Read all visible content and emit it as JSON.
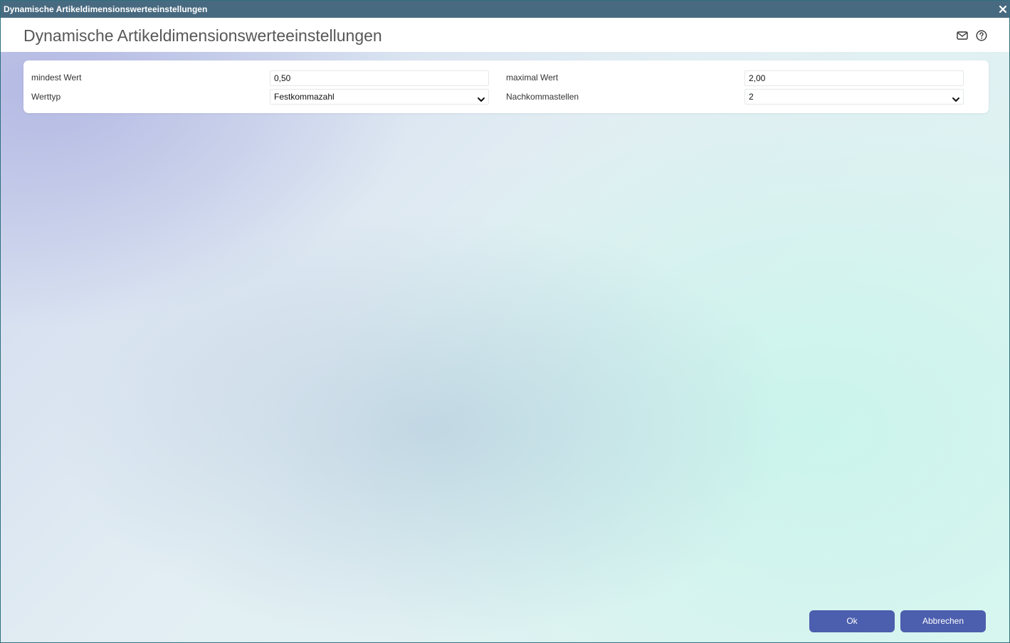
{
  "window": {
    "title": "Dynamische Artikeldimensionswerteeinstellungen",
    "close_icon": "close-icon"
  },
  "header": {
    "title": "Dynamische Artikeldimensionswerteeinstellungen",
    "icons": [
      "mail-icon",
      "help-icon"
    ]
  },
  "form": {
    "min_value": {
      "label": "mindest Wert",
      "value": "0,50"
    },
    "max_value": {
      "label": "maximal Wert",
      "value": "2,00"
    },
    "value_type": {
      "label": "Werttyp",
      "selected": "Festkommazahl"
    },
    "decimal_places": {
      "label": "Nachkommastellen",
      "selected": "2"
    }
  },
  "footer": {
    "ok_label": "Ok",
    "cancel_label": "Abbrechen"
  },
  "colors": {
    "titlebar": "#486a80",
    "button": "#4c5eae",
    "panel": "#ffffff"
  }
}
